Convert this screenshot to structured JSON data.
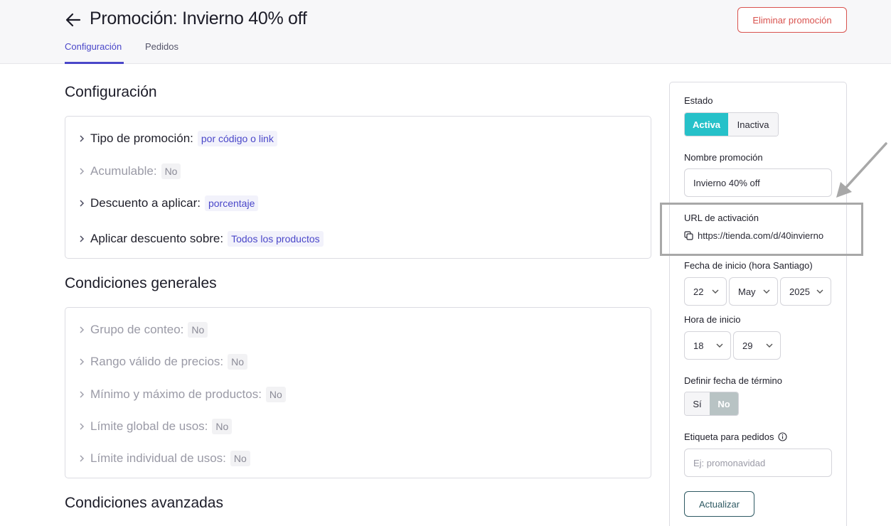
{
  "header": {
    "title": "Promoción: Invierno 40% off",
    "delete_label": "Eliminar promoción",
    "tabs": [
      {
        "label": "Configuración",
        "active": true
      },
      {
        "label": "Pedidos",
        "active": false
      }
    ]
  },
  "config": {
    "title": "Configuración",
    "rows": [
      {
        "label": "Tipo de promoción:",
        "value": "por código o link"
      },
      {
        "label": "Acumulable:",
        "value": "No"
      },
      {
        "label": "Descuento a aplicar:",
        "value": "porcentaje"
      },
      {
        "label": "Aplicar descuento sobre:",
        "value": "Todos los productos"
      }
    ]
  },
  "general": {
    "title": "Condiciones generales",
    "rows": [
      {
        "label": "Grupo de conteo:",
        "value": "No"
      },
      {
        "label": "Rango válido de precios:",
        "value": "No"
      },
      {
        "label": "Mínimo y máximo de productos:",
        "value": "No"
      },
      {
        "label": "Límite global de usos:",
        "value": "No"
      },
      {
        "label": "Límite individual de usos:",
        "value": "No"
      }
    ]
  },
  "advanced": {
    "title": "Condiciones avanzadas"
  },
  "sidebar": {
    "estado_label": "Estado",
    "estado_active": "Activa",
    "estado_inactive": "Inactiva",
    "nombre_label": "Nombre promoción",
    "nombre_value": "Invierno 40% off",
    "url_label": "URL de activación",
    "url_value": "https://tienda.com/d/40invierno",
    "fecha_label": "Fecha de inicio (hora Santiago)",
    "fecha_day": "22",
    "fecha_month": "May",
    "fecha_year": "2025",
    "hora_label": "Hora de inicio",
    "hora_hour": "18",
    "hora_minute": "29",
    "termino_label": "Definir fecha de término",
    "termino_yes": "Sí",
    "termino_no": "No",
    "etiqueta_label": "Etiqueta para pedidos",
    "etiqueta_placeholder": "Ej: promonavidad",
    "update_label": "Actualizar"
  },
  "colors": {
    "accent": "#4a47c9",
    "danger": "#d9534f",
    "teal": "#26c1c9"
  }
}
